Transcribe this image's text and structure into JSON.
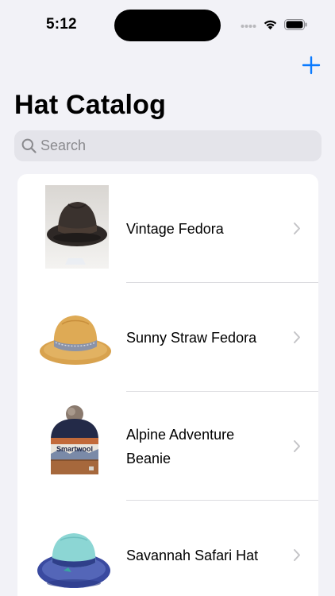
{
  "status_bar": {
    "time": "5:12",
    "icons": [
      "cellular-dots-icon",
      "wifi-icon",
      "battery-icon"
    ]
  },
  "nav": {
    "title": "Hat Catalog",
    "add_icon": "plus-icon",
    "accent_color": "#0a7aff"
  },
  "search": {
    "placeholder": "Search",
    "value": ""
  },
  "hats": [
    {
      "name": "Vintage Fedora",
      "image": "dark-brown-felt-fedora"
    },
    {
      "name": "Sunny Straw Fedora",
      "image": "straw-fedora-with-band"
    },
    {
      "name": "Alpine Adventure Beanie",
      "image": "navy-pompom-beanie",
      "image_text": "Smartwool"
    },
    {
      "name": "Savannah Safari Hat",
      "image": "teal-blue-woven-sun-hat"
    }
  ]
}
